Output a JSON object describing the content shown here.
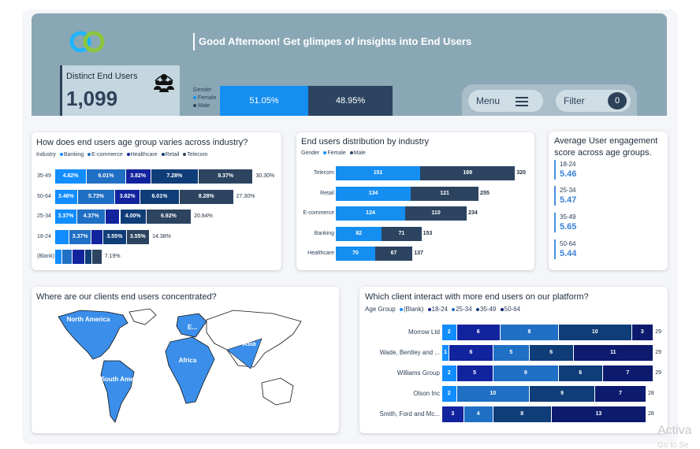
{
  "header": {
    "greeting": "Good Afternoon! Get glimpes of insights into End Users",
    "kpi_label": "Distinct End Users",
    "kpi_value": "1,099",
    "gender_title": "Gender",
    "gender_female": "Female",
    "gender_male": "Male",
    "female_pct": "51.05%",
    "male_pct": "48.95%",
    "menu_label": "Menu",
    "filter_label": "Filter",
    "filter_count": "0"
  },
  "colors": {
    "banking": "#118dff",
    "ecommerce": "#1f6fc4",
    "healthcare": "#12239e",
    "retail": "#0f3d78",
    "telecom": "#2c4460",
    "female": "#148ef0",
    "male": "#2c4460"
  },
  "age_industry": {
    "title": "How does end users age group varies across industry?",
    "legend_title": "Industry",
    "legend": [
      "Banking",
      "E-commerce",
      "Healthcare",
      "Retail",
      "Telecom"
    ],
    "rows": [
      {
        "label": "35-49",
        "values": [
          4.82,
          6.01,
          3.82,
          7.28,
          8.37
        ],
        "labels": [
          "4.82%",
          "6.01%",
          "3.82%",
          "7.28%",
          "8.37%"
        ],
        "total": "30.30%"
      },
      {
        "label": "50-64",
        "values": [
          3.46,
          5.73,
          3.82,
          6.01,
          8.28
        ],
        "labels": [
          "3.46%",
          "5.73%",
          "3.82%",
          "6.01%",
          "8.28%"
        ],
        "total": "27.30%"
      },
      {
        "label": "25-34",
        "values": [
          3.37,
          4.37,
          2.2,
          4.0,
          6.92
        ],
        "labels": [
          "3.37%",
          "4.37%",
          "",
          "4.00%",
          "6.92%"
        ],
        "total": "20.84%"
      },
      {
        "label": "18-24",
        "values": [
          2.2,
          3.37,
          1.8,
          3.55,
          3.55
        ],
        "labels": [
          "",
          "3.37%",
          "",
          "3.55%",
          "3.55%"
        ],
        "total": "14.38%"
      },
      {
        "label": "(Blank)",
        "values": [
          1.1,
          1.5,
          2.0,
          1.1,
          1.5
        ],
        "labels": [
          "",
          "",
          "",
          "",
          ""
        ],
        "total": "7.19%"
      }
    ]
  },
  "industry_dist": {
    "title": "End users distribution by industry",
    "legend_title": "Gender",
    "legend": [
      "Female",
      "Male"
    ],
    "rows": [
      {
        "label": "Telecom",
        "female": 151,
        "male": 169,
        "total": 320
      },
      {
        "label": "Retail",
        "female": 134,
        "male": 121,
        "total": 255
      },
      {
        "label": "E-commerce",
        "female": 124,
        "male": 110,
        "total": 234
      },
      {
        "label": "Banking",
        "female": 82,
        "male": 71,
        "total": 153
      },
      {
        "label": "Healthcare",
        "female": 70,
        "male": 67,
        "total": 137
      }
    ]
  },
  "engagement": {
    "title_line1": "Average User engagement",
    "title_line2": "score across age groups.",
    "items": [
      {
        "label": "18-24",
        "value": "5.46"
      },
      {
        "label": "25-34",
        "value": "5.47"
      },
      {
        "label": "35-49",
        "value": "5.65"
      },
      {
        "label": "50-64",
        "value": "5.44"
      }
    ]
  },
  "map": {
    "title": "Where are our clients end users concentrated?",
    "regions": [
      "North America",
      "Europe",
      "Asia",
      "Africa",
      "South America"
    ],
    "labels": {
      "north_america": "North America",
      "europe": "E...",
      "asia": "Asia",
      "africa": "Africa",
      "south_america": "South Ame..."
    }
  },
  "client_chart": {
    "title": "Which client interact with more end users on our platform?",
    "legend_title": "Age Group",
    "legend": [
      "(Blank)",
      "18-24",
      "25-34",
      "35-49",
      "50-64"
    ],
    "rows": [
      {
        "label": "Morrow Ltd",
        "values": [
          2,
          6,
          8,
          10,
          3
        ],
        "total": 29
      },
      {
        "label": "Wade, Bentley and ...",
        "values": [
          1,
          6,
          5,
          6,
          11
        ],
        "total": 29
      },
      {
        "label": "Williams Group",
        "values": [
          2,
          5,
          9,
          6,
          7
        ],
        "total": 29
      },
      {
        "label": "Olson Inc",
        "values": [
          2,
          0,
          10,
          9,
          7
        ],
        "total": 28
      },
      {
        "label": "Smith, Ford and Mc...",
        "values": [
          0,
          3,
          4,
          8,
          13
        ],
        "total": 28
      }
    ]
  },
  "watermark": {
    "line1": "Activa",
    "line2": "Go to Se"
  }
}
